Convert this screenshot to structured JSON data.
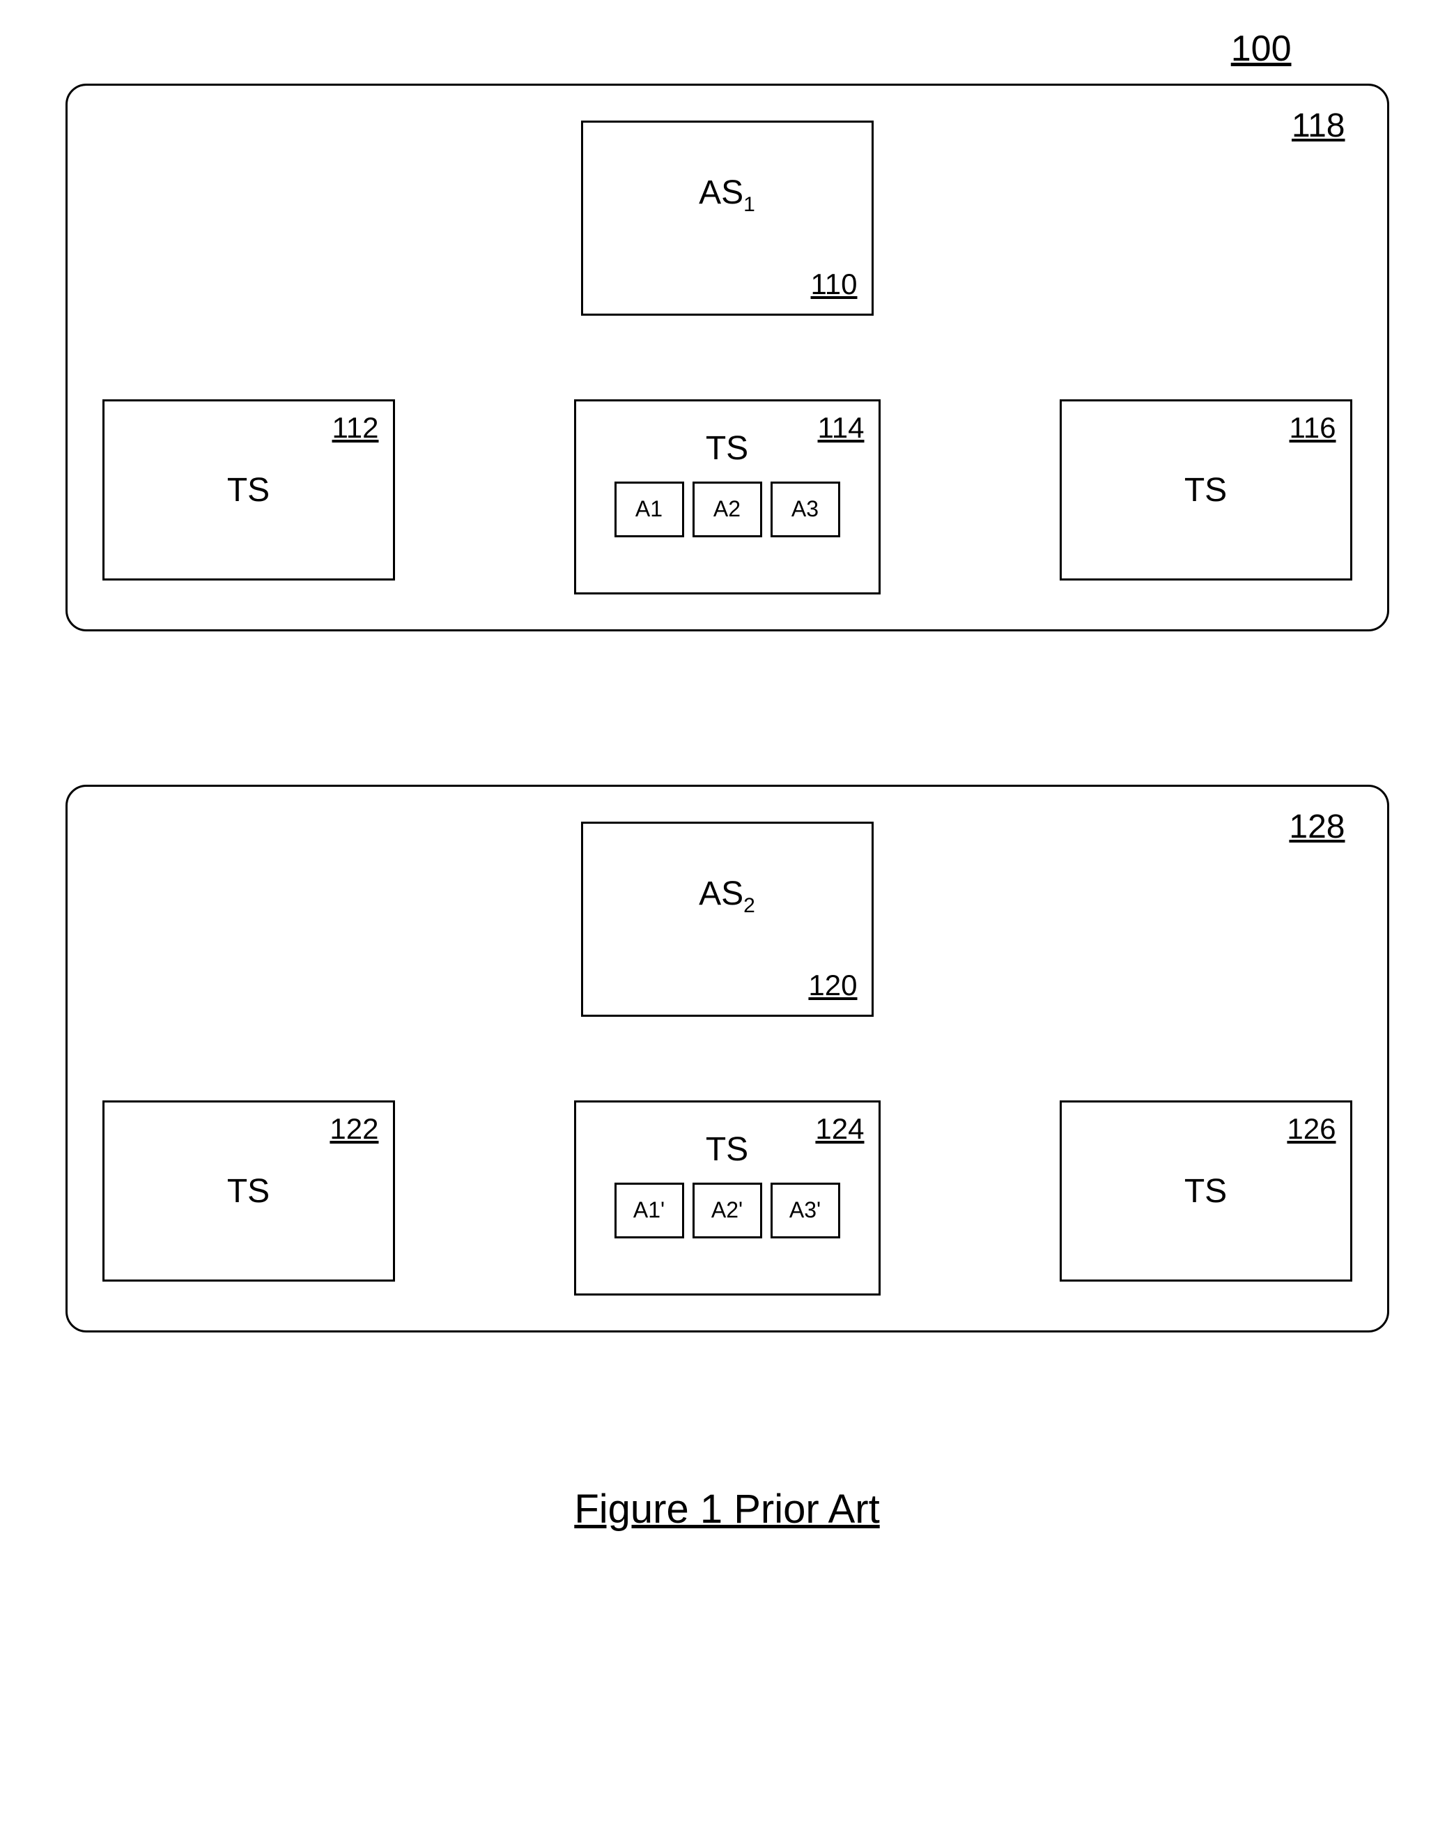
{
  "figure_number": "100",
  "groups": [
    {
      "ref": "118",
      "as": {
        "label": "AS",
        "sub": "1",
        "ref": "110"
      },
      "ts": [
        {
          "ref": "112",
          "label": "TS",
          "apps": []
        },
        {
          "ref": "114",
          "label": "TS",
          "apps": [
            "A1",
            "A2",
            "A3"
          ]
        },
        {
          "ref": "116",
          "label": "TS",
          "apps": []
        }
      ]
    },
    {
      "ref": "128",
      "as": {
        "label": "AS",
        "sub": "2",
        "ref": "120"
      },
      "ts": [
        {
          "ref": "122",
          "label": "TS",
          "apps": []
        },
        {
          "ref": "124",
          "label": "TS",
          "apps": [
            "A1'",
            "A2'",
            "A3'"
          ]
        },
        {
          "ref": "126",
          "label": "TS",
          "apps": []
        }
      ]
    }
  ],
  "caption": "Figure 1  Prior Art"
}
